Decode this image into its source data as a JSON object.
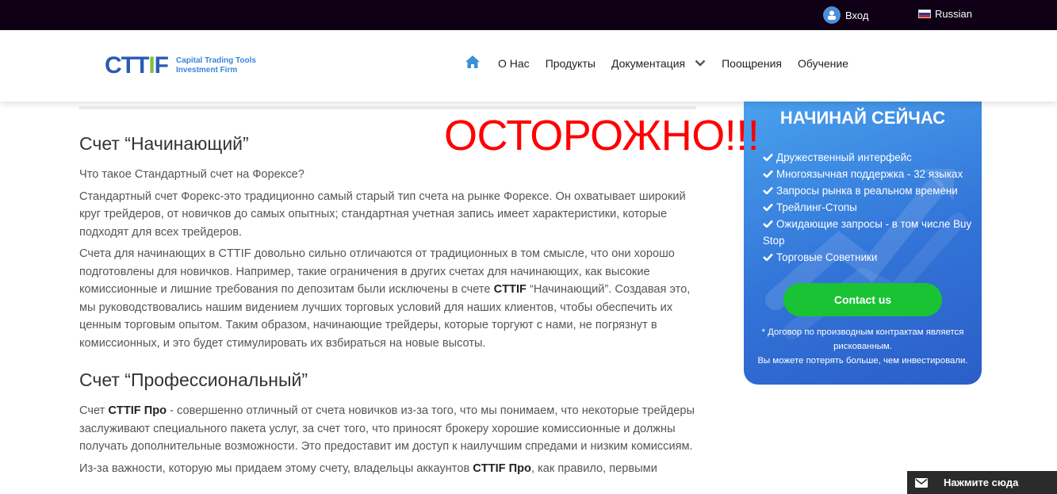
{
  "topbar": {
    "login_label": "Вход",
    "language_label": "Russian"
  },
  "brand": {
    "logo_mark": "CTTIF",
    "tagline_line1": "Capital Trading Tools",
    "tagline_line2": "Investment Firm",
    "primary_color": "#2a5bb6",
    "accent_color": "#7bc043"
  },
  "nav": {
    "home_icon": "home-icon",
    "items": [
      "О Нас",
      "Продукты",
      "Документация",
      "Поощрения",
      "Обучение"
    ]
  },
  "warning": {
    "text": "ОСТОРОЖНО!!!",
    "color": "#ff0000"
  },
  "article": {
    "section1": {
      "title": "Счет “Начинающий”",
      "p1": "Что такое Стандартный счет на Форексе?",
      "p2": "Стандартный счет Форекс-это традиционно самый старый тип счета на рынке Форексе. Он охватывает широкий круг трейдеров, от новичков до самых опытных; стандартная учетная запись имеет характеристики, которые подходят для всех трейдеров.",
      "p3_a": "Счета для начинающих в CTTIF довольно сильно отличаются от традиционных в том смысле, что они хорошо подготовлены для новичков. Например, такие ограничения в других счетах для начинающих, как высокие комиссионные и лишние требования по депозитам были исключены в счете ",
      "p3_b": "CTTIF",
      "p3_c": " “Начинающий”. Создавая это, мы руководствовались нашим видением лучших торговых условий для наших клиентов, чтобы обеспечить их ценным торговым опытом. Таким образом, начинающие трейдеры, которые торгуют с нами, не погрязнут в комиссионных, и это будет стимулировать их взбираться на новые высоты."
    },
    "section2": {
      "title": "Счет “Профессиональный”",
      "p1_a": "Счет ",
      "p1_b": "CTTIF Про",
      "p1_c": " -  совершенно отличный от счета новичков из-за того, что мы понимаем, что некоторые трейдеры заслуживают специального пакета услуг, за счет того, что приносят брокеру хорошие комиссионные и должны получать дополнительные возможности. Это предоставит им доступ к наилучшим спредами и низким комиссиям.",
      "p2_a": "Из-за важности, которую мы придаем этому счету, владельцы аккаунтов ",
      "p2_b": "CTTIF Про",
      "p2_c": ", как правило, первыми"
    }
  },
  "promo": {
    "title": "НАЧИНАЙ СЕЙЧАС",
    "features": [
      "Дружественный интерфейс",
      "Многоязычная поддержка - 32 языках",
      "Запросы рынка в реальном времени",
      "Трейлинг-Стопы",
      "Ожидающие запросы - в том числе Buy Stop",
      "Торговые Советники"
    ],
    "cta_label": "Contact us",
    "disclaimer_line1": "* Договор по производным контрактам является",
    "disclaimer_line2": "рискованным.",
    "disclaimer_line3": "Вы можете потерять больше, чем инвестировали.",
    "cta_color": "#19c334"
  },
  "chat": {
    "label": "Нажмите сюда",
    "icon": "envelope-icon"
  }
}
